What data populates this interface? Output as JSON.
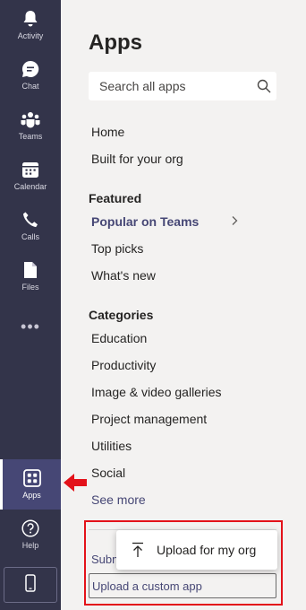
{
  "rail": {
    "items": [
      {
        "label": "Activity",
        "icon": "bell-icon"
      },
      {
        "label": "Chat",
        "icon": "chat-icon"
      },
      {
        "label": "Teams",
        "icon": "teams-icon"
      },
      {
        "label": "Calendar",
        "icon": "calendar-icon"
      },
      {
        "label": "Calls",
        "icon": "phone-icon"
      },
      {
        "label": "Files",
        "icon": "file-icon"
      }
    ],
    "more": "•••",
    "apps_label": "Apps",
    "help_label": "Help"
  },
  "main": {
    "title": "Apps",
    "search_placeholder": "Search all apps",
    "nav": [
      "Home",
      "Built for your org"
    ],
    "featured_heading": "Featured",
    "featured": [
      "Popular on Teams",
      "Top picks",
      "What's new"
    ],
    "categories_heading": "Categories",
    "categories": [
      "Education",
      "Productivity",
      "Image & video galleries",
      "Project management",
      "Utilities",
      "Social"
    ],
    "see_more": "See more",
    "submit_partial": "Subm",
    "upload_custom": "Upload a custom app"
  },
  "popup": {
    "label": "Upload for my org"
  },
  "colors": {
    "rail_bg": "#33344a",
    "accent": "#464775",
    "highlight_red": "#e3121a",
    "panel_bg": "#f3f2f1"
  }
}
